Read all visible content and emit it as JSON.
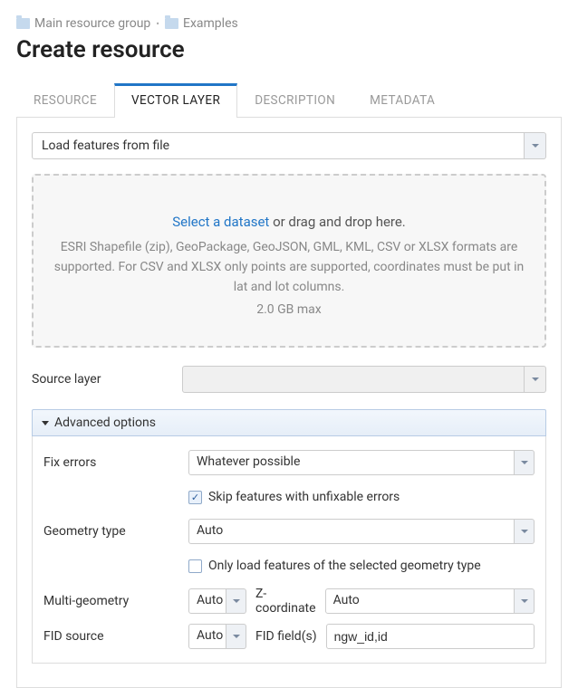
{
  "breadcrumb": [
    {
      "label": "Main resource group"
    },
    {
      "label": "Examples"
    }
  ],
  "title": "Create resource",
  "tabs": [
    {
      "id": "resource",
      "label": "RESOURCE",
      "active": false
    },
    {
      "id": "vector-layer",
      "label": "VECTOR LAYER",
      "active": true
    },
    {
      "id": "description",
      "label": "DESCRIPTION",
      "active": false
    },
    {
      "id": "metadata",
      "label": "METADATA",
      "active": false
    }
  ],
  "load_mode": {
    "value": "Load features from file"
  },
  "dropzone": {
    "select_link": "Select a dataset",
    "drag_text": " or drag and drop here.",
    "formats": "ESRI Shapefile (zip), GeoPackage, GeoJSON, GML, KML, CSV or XLSX formats are supported. For CSV and XLSX only points are supported, coordinates must be put in lat and lot columns.",
    "max": "2.0 GB max"
  },
  "source_layer": {
    "label": "Source layer",
    "value": ""
  },
  "advanced": {
    "header": "Advanced options",
    "fix_errors": {
      "label": "Fix errors",
      "value": "Whatever possible",
      "skip_label": "Skip features with unfixable errors",
      "skip_checked": true
    },
    "geometry_type": {
      "label": "Geometry type",
      "value": "Auto",
      "only_label": "Only load features of the selected geometry type",
      "only_checked": false
    },
    "multi_geometry": {
      "label": "Multi-geometry",
      "value": "Auto"
    },
    "z_coordinate": {
      "label": "Z-coordinate",
      "value": "Auto"
    },
    "fid_source": {
      "label": "FID source",
      "value": "Auto"
    },
    "fid_fields": {
      "label": "FID field(s)",
      "value": "ngw_id,id"
    }
  }
}
